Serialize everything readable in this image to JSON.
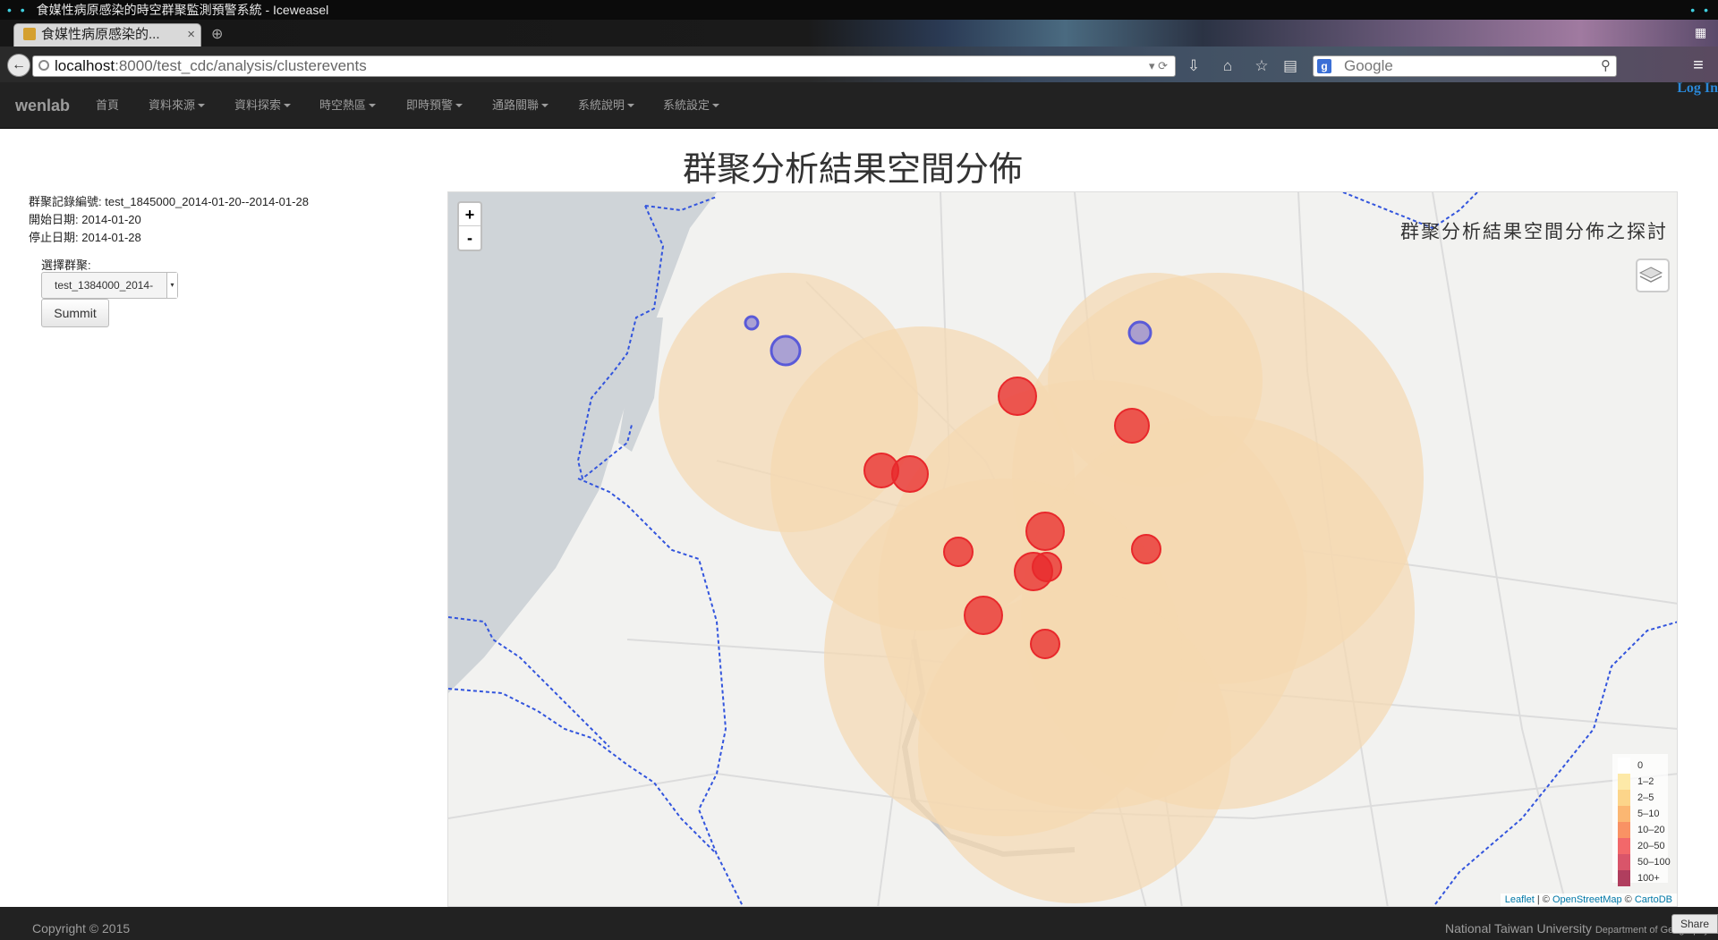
{
  "window": {
    "title": "食媒性病原感染的時空群聚監測預警系統 - Iceweasel"
  },
  "browser": {
    "tab_title": "食媒性病原感染的...",
    "url_host": "localhost",
    "url_rest": ":8000/test_cdc/analysis/clusterevents",
    "search_engine": "Google",
    "search_placeholder": "Google"
  },
  "nav": {
    "brand": "wenlab",
    "items": [
      "首頁",
      "資料來源",
      "資料探索",
      "時空熱區",
      "即時預警",
      "通路關聯",
      "系統說明",
      "系統設定"
    ],
    "login": "Log In"
  },
  "page": {
    "title": "群聚分析結果空間分佈"
  },
  "sidebar": {
    "record_id_label": "群聚記錄編號:",
    "record_id": "test_1845000_2014-01-20--2014-01-28",
    "start_label": "開始日期:",
    "start_date": "2014-01-20",
    "end_label": "停止日期:",
    "end_date": "2014-01-28",
    "select_label": "選擇群聚:",
    "select_value": "test_1384000_2014-",
    "submit_label": "Summit"
  },
  "map": {
    "overlay_title": "群聚分析結果空間分佈之探討",
    "zoom_in": "+",
    "zoom_out": "-",
    "legend": [
      {
        "label": "0",
        "color": "#ffffff"
      },
      {
        "label": "1–2",
        "color": "#fde9a8"
      },
      {
        "label": "2–5",
        "color": "#fcd58a"
      },
      {
        "label": "5–10",
        "color": "#fbb772"
      },
      {
        "label": "10–20",
        "color": "#f99264"
      },
      {
        "label": "20–50",
        "color": "#f2686a"
      },
      {
        "label": "50–100",
        "color": "#d9556a"
      },
      {
        "label": "100+",
        "color": "#b03e5e"
      }
    ],
    "attribution": {
      "leaflet": "Leaflet",
      "sep1": " | © ",
      "osm": "OpenStreetMap",
      "sep2": " © ",
      "carto": "CartoDB"
    },
    "colors": {
      "buffer": "#f5d9b0",
      "red_cluster": "#e8282b",
      "blue_cluster": "#6e6ee0",
      "boundary": "#3355dd"
    }
  },
  "footer": {
    "copyright": "Copyright © 2015",
    "org": "National Taiwan University",
    "dept": "Department of Geography",
    "share": "Share"
  }
}
